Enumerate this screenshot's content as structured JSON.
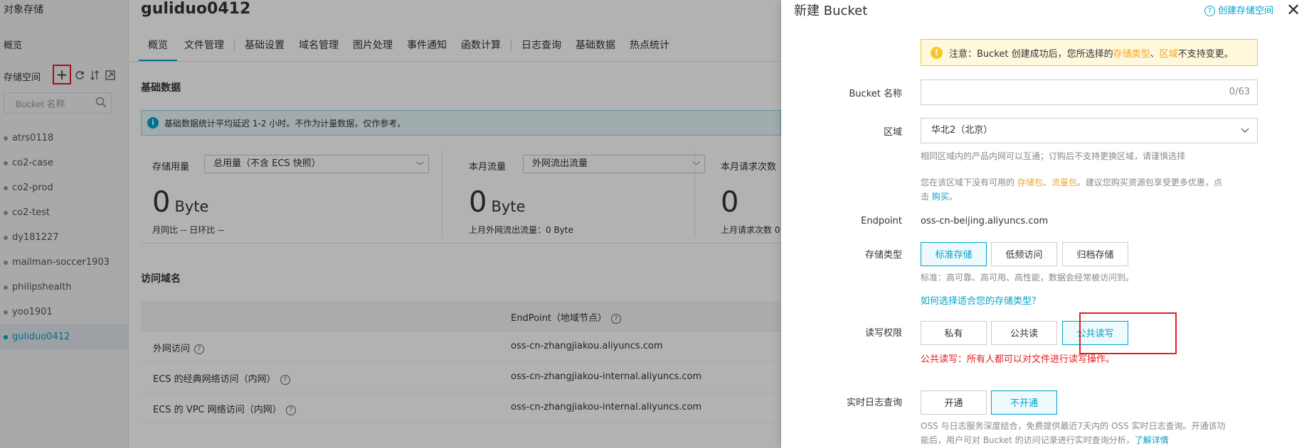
{
  "sidebar": {
    "title": "对象存储",
    "overview": "概览",
    "bucket_header": "存储空间",
    "add_glyph": "+",
    "search_placeholder": "Bucket 名称",
    "buckets": [
      {
        "name": "atrs0118",
        "active": false
      },
      {
        "name": "co2-case",
        "active": false
      },
      {
        "name": "co2-prod",
        "active": false
      },
      {
        "name": "co2-test",
        "active": false
      },
      {
        "name": "dy181227",
        "active": false
      },
      {
        "name": "mailman-soccer1903",
        "active": false
      },
      {
        "name": "philipshealth",
        "active": false
      },
      {
        "name": "yoo1901",
        "active": false
      },
      {
        "name": "guliduo0412",
        "active": true
      }
    ]
  },
  "main": {
    "title": "guliduo0412",
    "tabs": [
      "概览",
      "文件管理",
      "基础设置",
      "域名管理",
      "图片处理",
      "事件通知",
      "函数计算",
      "日志查询",
      "基础数据",
      "热点统计"
    ],
    "basic_data_heading": "基础数据",
    "info_text": "基础数据统计平均延迟 1-2 小时。不作为计量数据，仅作参考。",
    "stats": [
      {
        "label": "存储用量",
        "select": "总用量（不含 ECS 快照）",
        "value": "0",
        "unit": "Byte",
        "sub": "月同比  --   日环比  --"
      },
      {
        "label": "本月流量",
        "select": "外网流出流量",
        "value": "0",
        "unit": "Byte",
        "sub": "上月外网流出流量：0 Byte"
      },
      {
        "label": "本月请求次数",
        "select": "",
        "value": "0",
        "unit": "",
        "sub": "上月请求次数  0"
      }
    ],
    "access_heading": "访问域名",
    "endpoint_header": "EndPoint（地域节点）",
    "rows": [
      {
        "name": "外网访问",
        "endpoint": "oss-cn-zhangjiakou.aliyuncs.com"
      },
      {
        "name": "ECS 的经典网络访问（内网）",
        "endpoint": "oss-cn-zhangjiakou-internal.aliyuncs.com"
      },
      {
        "name": "ECS 的 VPC 网络访问（内网）",
        "endpoint": "oss-cn-zhangjiakou-internal.aliyuncs.com"
      }
    ]
  },
  "drawer": {
    "title": "新建 Bucket",
    "help_link": "创建存储空间",
    "close_glyph": "✕",
    "warning": {
      "prefix": "注意：Bucket 创建成功后，您所选择的",
      "hl1": "存储类型",
      "sep": "、",
      "hl2": "区域",
      "suffix": "不支持变更。"
    },
    "bucket_name_label": "Bucket 名称",
    "bucket_name_value": "",
    "bucket_name_counter": "0/63",
    "region_label": "区域",
    "region_value": "华北2（北京）",
    "region_hint": "相同区域内的产品内网可以互通；订购后不支持更换区域，请谨慎选择",
    "resource_hint": {
      "p1": "您在该区域下没有可用的 ",
      "hl1": "存储包",
      "sep": "、",
      "hl2": "流量包",
      "p2": "。建议您购买资源包享受更多优惠，点",
      "p3": "击 ",
      "link": "购买",
      "p4": "。"
    },
    "endpoint_label": "Endpoint",
    "endpoint_value": "oss-cn-beijing.aliyuncs.com",
    "storage_label": "存储类型",
    "storage_options": [
      {
        "label": "标准存储",
        "selected": true
      },
      {
        "label": "低频访问",
        "selected": false
      },
      {
        "label": "归档存储",
        "selected": false
      }
    ],
    "storage_hint": "标准：高可靠、高可用、高性能，数据会经常被访问到。",
    "storage_link": "如何选择适合您的存储类型？",
    "acl_label": "读写权限",
    "acl_options": [
      {
        "label": "私有",
        "selected": false
      },
      {
        "label": "公共读",
        "selected": false
      },
      {
        "label": "公共读写",
        "selected": true
      }
    ],
    "acl_warning": "公共读写：所有人都可以对文件进行读写操作。",
    "log_label": "实时日志查询",
    "log_options": [
      {
        "label": "开通",
        "selected": false
      },
      {
        "label": "不开通",
        "selected": true
      }
    ],
    "log_hint": {
      "l1": "OSS 与日志服务深度结合，免费提供最近7天内的 OSS 实时日志查询。开通该功",
      "l2": "能后，用户可对 Bucket 的访问记录进行实时查询分析，",
      "link": "了解详情"
    }
  },
  "colors": {
    "accent": "#00a2ca",
    "warning": "#f5a623",
    "error": "#e41e1e",
    "highlight_box": "#e41e1e"
  }
}
